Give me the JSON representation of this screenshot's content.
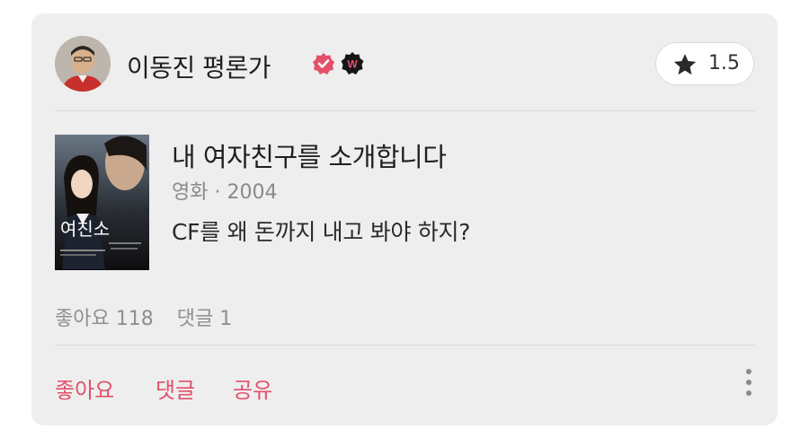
{
  "author": {
    "name": "이동진 평론가",
    "avatar": "avatar",
    "verified_icon": "verified-check-icon",
    "badge_icon": "watcha-w-badge-icon",
    "badge_letter": "W"
  },
  "rating": {
    "icon": "star-icon",
    "value": "1.5"
  },
  "movie": {
    "title": "내 여자친구를 소개합니다",
    "meta": "영화 · 2004",
    "poster_text": "여친소"
  },
  "review": {
    "text": "CF를 왜 돈까지 내고 봐야 하지?"
  },
  "stats": {
    "likes": "좋아요 118",
    "comments": "댓글 1"
  },
  "actions": {
    "like": "좋아요",
    "comment": "댓글",
    "share": "공유",
    "more_icon": "more-vertical-icon"
  },
  "colors": {
    "accent": "#e2506a",
    "card_bg": "#eeeeef",
    "text": "#1f1f1f",
    "muted": "#8a8a8a"
  }
}
